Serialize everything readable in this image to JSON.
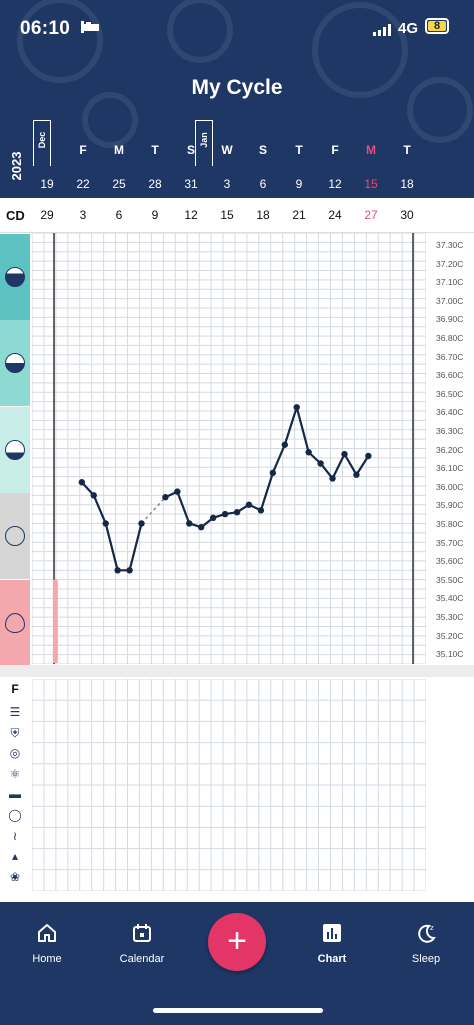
{
  "status_bar": {
    "time": "06:10",
    "network": "4G",
    "battery": "8",
    "bed_icon": "bed-icon",
    "signal_icon": "signal-bars-icon"
  },
  "header": {
    "title": "My Cycle",
    "year": "2023"
  },
  "months": [
    {
      "label": "Dec"
    },
    {
      "label": "Jan"
    }
  ],
  "dates": [
    {
      "dow": "",
      "day": "19"
    },
    {
      "dow": "F",
      "day": "22"
    },
    {
      "dow": "M",
      "day": "25"
    },
    {
      "dow": "T",
      "day": "28"
    },
    {
      "dow": "S",
      "day": "31"
    },
    {
      "dow": "W",
      "day": "3"
    },
    {
      "dow": "S",
      "day": "6"
    },
    {
      "dow": "T",
      "day": "9"
    },
    {
      "dow": "F",
      "day": "12"
    },
    {
      "dow": "M",
      "day": "15"
    },
    {
      "dow": "T",
      "day": "18"
    }
  ],
  "highlight_color": "#e84a78",
  "cycle_days": {
    "label": "CD",
    "values": [
      "29",
      "3",
      "6",
      "9",
      "12",
      "15",
      "18",
      "21",
      "24",
      "27",
      "30"
    ]
  },
  "side_icons": [
    {
      "icon": "cervical-fluid-egg-white-icon",
      "color": "#5dc3c2"
    },
    {
      "icon": "cervical-fluid-watery-icon",
      "color": "#8fd9d3"
    },
    {
      "icon": "cervical-fluid-creamy-icon",
      "color": "#c8ede8"
    },
    {
      "icon": "cervical-fluid-dry-icon",
      "color": "#d6d6d6"
    },
    {
      "icon": "menstruation-drop-icon",
      "color": "#f4a7ad"
    }
  ],
  "temperatures": [
    "37.30C",
    "37.20C",
    "37.10C",
    "37.00C",
    "36.90C",
    "36.80C",
    "36.70C",
    "36.60C",
    "36.50C",
    "36.40C",
    "36.30C",
    "36.20C",
    "36.10C",
    "36.00C",
    "35.90C",
    "35.80C",
    "35.70C",
    "35.60C",
    "35.50C",
    "35.40C",
    "35.30C",
    "35.20C",
    "35.10C"
  ],
  "chart_data": {
    "type": "line",
    "ylim": [
      35.05,
      37.35
    ],
    "x_day_range": [
      0,
      33
    ],
    "series": [
      {
        "values": [
          {
            "x": 3,
            "y": 36.02
          },
          {
            "x": 4,
            "y": 35.95
          },
          {
            "x": 5,
            "y": 35.8
          },
          {
            "x": 6,
            "y": 35.55
          },
          {
            "x": 7,
            "y": 35.55
          },
          {
            "x": 8,
            "y": 35.8
          },
          {
            "x": 10,
            "y": 35.94
          },
          {
            "x": 11,
            "y": 35.97
          },
          {
            "x": 12,
            "y": 35.8
          },
          {
            "x": 13,
            "y": 35.78
          },
          {
            "x": 14,
            "y": 35.83
          },
          {
            "x": 15,
            "y": 35.85
          },
          {
            "x": 16,
            "y": 35.86
          },
          {
            "x": 17,
            "y": 35.9
          },
          {
            "x": 18,
            "y": 35.87
          },
          {
            "x": 19,
            "y": 36.07
          },
          {
            "x": 20,
            "y": 36.22
          },
          {
            "x": 21,
            "y": 36.42
          },
          {
            "x": 22,
            "y": 36.18
          },
          {
            "x": 23,
            "y": 36.12
          },
          {
            "x": 24,
            "y": 36.04
          },
          {
            "x": 25,
            "y": 36.17
          },
          {
            "x": 26,
            "y": 36.06
          },
          {
            "x": 27,
            "y": 36.16
          }
        ]
      }
    ],
    "gap": [
      8,
      10
    ],
    "period_days": [
      3
    ],
    "grid": true
  },
  "lower_panel": {
    "label": "F",
    "icons": [
      "notes-icon",
      "shield-icon",
      "contraception-icon",
      "atom-icon",
      "pill-icon",
      "circle-icon",
      "spotting-icon",
      "drop-icon",
      "lightbulb-icon"
    ]
  },
  "nav": {
    "home": "Home",
    "calendar": "Calendar",
    "add": "+",
    "chart": "Chart",
    "sleep": "Sleep"
  }
}
